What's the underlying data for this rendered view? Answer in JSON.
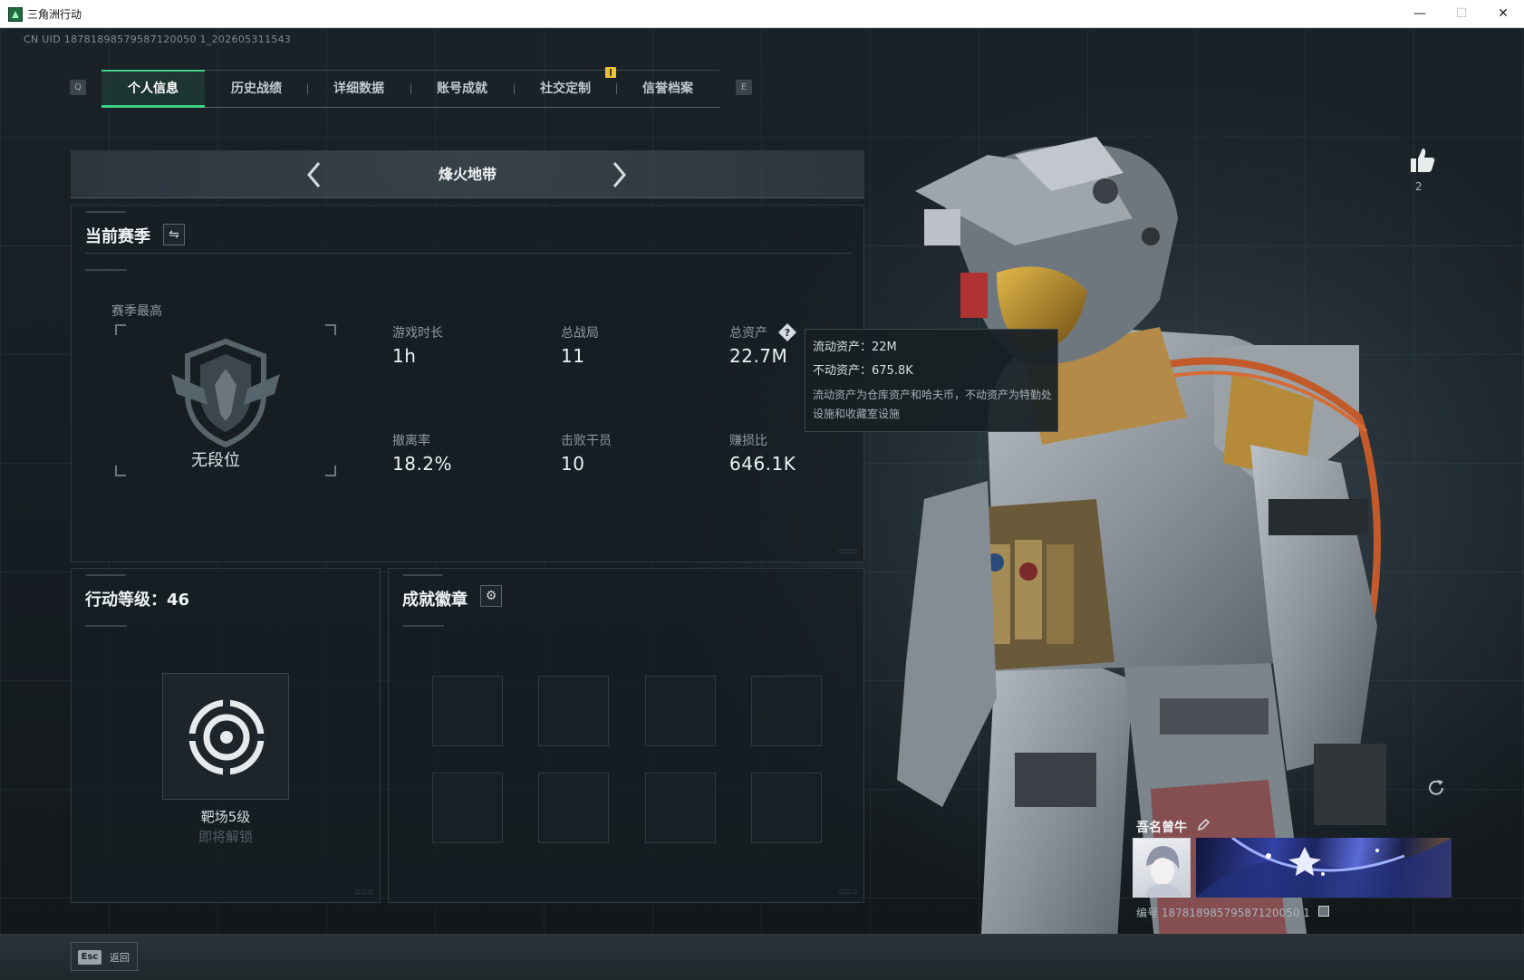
{
  "window": {
    "title": "三角洲行动",
    "controls": {
      "minimize": "—",
      "maximize": "☐",
      "close": "✕"
    }
  },
  "uid_text": "CN UID 18781898579587120050 1_202605311543",
  "tabs": {
    "prev_key": "Q",
    "next_key": "E",
    "items": [
      {
        "label": "个人信息",
        "active": true
      },
      {
        "label": "历史战绩",
        "active": false
      },
      {
        "label": "详细数据",
        "active": false
      },
      {
        "label": "账号成就",
        "active": false
      },
      {
        "label": "社交定制",
        "active": false
      },
      {
        "label": "信誉档案",
        "active": false
      }
    ]
  },
  "mode": {
    "title": "烽火地带"
  },
  "season": {
    "title": "当前赛季",
    "best_label": "赛季最高",
    "rank": "无段位",
    "stats": [
      {
        "label": "游戏时长",
        "value": "1h"
      },
      {
        "label": "总战局",
        "value": "11"
      },
      {
        "label": "总资产",
        "value": "22.7M"
      },
      {
        "label": "撤离率",
        "value": "18.2%"
      },
      {
        "label": "击败干员",
        "value": "10"
      },
      {
        "label": "赚损比",
        "value": "646.1K"
      }
    ]
  },
  "tooltip": {
    "liquid": "流动资产：22M",
    "fixed": "不动资产：675.8K",
    "description": "流动资产为仓库资产和哈夫币，不动资产为特勤处设施和收藏室设施"
  },
  "action_level": {
    "title": "行动等级：46",
    "level_name": "靶场5级",
    "unlock_text": "即将解锁"
  },
  "badges": {
    "title": "成就徽章",
    "slots": 8
  },
  "profile": {
    "likes": "2",
    "name": "吾名曾牛",
    "id_text": "编号 18781898579587120050 1"
  },
  "bottom": {
    "esc_key": "Esc",
    "esc_label": "返回"
  },
  "colors": {
    "accent": "#3fd08a",
    "notify": "#e8c23a",
    "text_primary": "#eef2f3",
    "text_muted": "#8f999e"
  }
}
